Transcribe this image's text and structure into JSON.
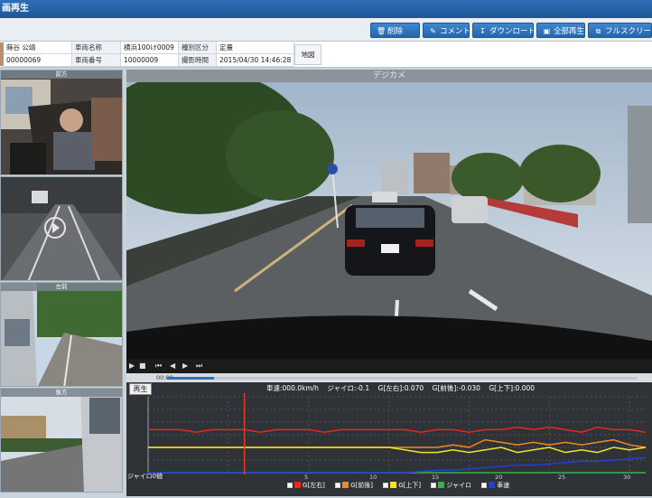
{
  "window": {
    "title": "画再生"
  },
  "toolbar": {
    "delete_label": "削除",
    "comment_label": "コメント",
    "download_label": "ダウンロード",
    "play_all_label": "全部再生",
    "fullscreen_label": "フルスクリーン",
    "delete_icon": "trash-icon",
    "comment_icon": "edit-icon",
    "download_icon": "download-icon",
    "play_all_icon": "play-all-icon",
    "fullscreen_icon": "fullscreen-icon"
  },
  "info": {
    "driver_name": "蒔谷 公靖",
    "driver_id": "00000069",
    "vehicle_name_label": "車両名称",
    "vehicle_name": "横浜100け0009",
    "vehicle_no_label": "車両番号",
    "vehicle_no": "10000009",
    "type_label": "種別区分",
    "type_value": "定量",
    "shot_time_label": "撮影時間",
    "shot_time": "2015/04/30 14:46:28",
    "map_label": "地図"
  },
  "cameras": {
    "front": "前方",
    "left": "左前",
    "rear": "後方",
    "main": "デジカメ"
  },
  "player": {
    "current_time": "00:08",
    "progress": 0.1,
    "play_label": "再生"
  },
  "readout": {
    "speed": "車速:000.0km/h",
    "gyro": "ジャイロ:-0.1",
    "g_lr": "G[左右]:0.070",
    "g_fb": "G[前後]:-0.030",
    "g_ud": "G[上下]:0.000"
  },
  "graph": {
    "ylabel": "ジャイロ0値",
    "xticks": [
      "5",
      "10",
      "15",
      "20",
      "25",
      "30"
    ]
  },
  "legend": [
    {
      "label": "G[左右]",
      "color": "#e8271f"
    },
    {
      "label": "G[前後]",
      "color": "#f08a1c"
    },
    {
      "label": "G[上下]",
      "color": "#f2e32c"
    },
    {
      "label": "ジャイロ",
      "color": "#37b34a"
    },
    {
      "label": "車速",
      "color": "#2140d6"
    }
  ],
  "chart_data": {
    "type": "line",
    "x": [
      0,
      1,
      2,
      3,
      4,
      5,
      6,
      7,
      8,
      9,
      10,
      11,
      12,
      13,
      14,
      15,
      16,
      17,
      18,
      19,
      20,
      21,
      22,
      23,
      24,
      25,
      26,
      27,
      28,
      29,
      30,
      31
    ],
    "series": [
      {
        "name": "G[左右]",
        "values": [
          0.07,
          0.07,
          0.07,
          0.06,
          0.07,
          0.07,
          0.07,
          0.06,
          0.07,
          0.07,
          0.07,
          0.06,
          0.07,
          0.07,
          0.07,
          0.07,
          0.07,
          0.06,
          0.07,
          0.07,
          0.06,
          0.07,
          0.07,
          0.08,
          0.07,
          0.08,
          0.07,
          0.06,
          0.08,
          0.07,
          0.07,
          0.06
        ]
      },
      {
        "name": "G[前後]",
        "values": [
          0.0,
          0.0,
          0.0,
          0.0,
          0.0,
          0.0,
          0.0,
          0.0,
          0.0,
          0.0,
          0.0,
          0.0,
          0.0,
          0.0,
          0.0,
          0.0,
          0.0,
          0.0,
          0.0,
          0.01,
          0.0,
          0.03,
          0.02,
          0.01,
          0.02,
          0.01,
          0.02,
          0.01,
          0.02,
          0.03,
          0.01,
          0.0
        ]
      },
      {
        "name": "G[上下]",
        "values": [
          0.0,
          0.0,
          0.0,
          0.0,
          0.0,
          0.0,
          0.0,
          0.0,
          0.0,
          0.0,
          0.0,
          0.0,
          0.0,
          0.0,
          0.0,
          0.0,
          -0.01,
          -0.02,
          -0.02,
          -0.01,
          -0.02,
          -0.01,
          0.0,
          -0.02,
          -0.01,
          0.0,
          -0.02,
          -0.01,
          -0.02,
          0.0,
          -0.01,
          0.0
        ]
      },
      {
        "name": "ジャイロ",
        "values": [
          -0.1,
          -0.1,
          -0.1,
          -0.1,
          -0.1,
          -0.1,
          -0.1,
          -0.1,
          -0.1,
          -0.1,
          -0.1,
          -0.1,
          -0.1,
          -0.1,
          -0.1,
          -0.1,
          -0.1,
          -0.1,
          -0.1,
          -0.1,
          -0.1,
          -0.1,
          -0.1,
          -0.1,
          -0.1,
          -0.1,
          -0.1,
          -0.1,
          -0.1,
          -0.1,
          -0.1,
          -0.1
        ]
      },
      {
        "name": "車速",
        "values": [
          0,
          0,
          0,
          0,
          0,
          0,
          0,
          0,
          0,
          0,
          0,
          0,
          0,
          0,
          0,
          0,
          0,
          1,
          2,
          2,
          3,
          4,
          5,
          6,
          6,
          7,
          8,
          9,
          9,
          10,
          11,
          12
        ]
      }
    ],
    "ylim": [
      -0.1,
      0.2
    ],
    "cursor_x": 6
  }
}
